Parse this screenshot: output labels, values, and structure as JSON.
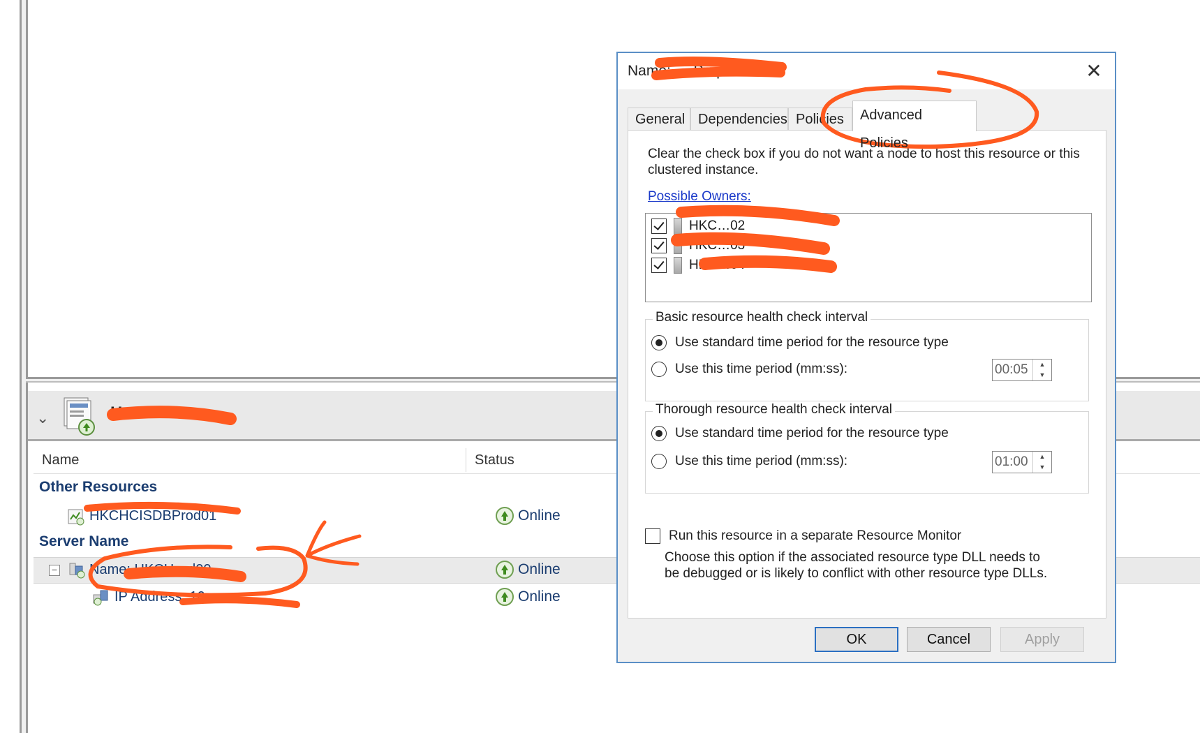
{
  "role": {
    "name": "H…d01"
  },
  "table": {
    "columns": [
      "Name",
      "Status"
    ],
    "groups": {
      "other_resources": "Other Resources",
      "server_name": "Server Name"
    },
    "rows": [
      {
        "name": "HKCHCISDBProd01",
        "status": "Online"
      },
      {
        "name": "Name: HKCH…d00",
        "status": "Online"
      },
      {
        "name": "IP Address: 10.…",
        "status": "Online"
      }
    ]
  },
  "dialog": {
    "title": "Name: … Properties",
    "close_glyph": "✕",
    "tabs": [
      "General",
      "Dependencies",
      "Policies",
      "Advanced Policies"
    ],
    "active_tab": "Advanced Policies",
    "description": "Clear the check box if you do not want a node to host this resource or this clustered instance.",
    "possible_owners_link": "Possible Owners:",
    "owners": [
      {
        "name": "HKC…02",
        "checked": true
      },
      {
        "name": "HKC…03",
        "checked": true
      },
      {
        "name": "HKC…04",
        "checked": true
      }
    ],
    "basic_interval": {
      "legend": "Basic resource health check interval",
      "option_standard": "Use standard time period for the resource type",
      "option_custom": "Use this time period (mm:ss):",
      "value": "00:05",
      "selected": "standard"
    },
    "thorough_interval": {
      "legend": "Thorough resource health check interval",
      "option_standard": "Use standard time period for the resource type",
      "option_custom": "Use this time period (mm:ss):",
      "value": "01:00",
      "selected": "standard"
    },
    "separate_monitor": {
      "label": "Run this resource in a separate Resource Monitor",
      "description": "Choose this option if the associated resource type DLL needs to be debugged or is likely to conflict with other resource type DLLs.",
      "checked": false
    },
    "buttons": {
      "ok": "OK",
      "cancel": "Cancel",
      "apply": "Apply"
    }
  },
  "colors": {
    "annotation": "#ff5a1f",
    "link": "#1a39c9",
    "group_text": "#1b3d70",
    "dialog_border": "#5a8fc6"
  }
}
